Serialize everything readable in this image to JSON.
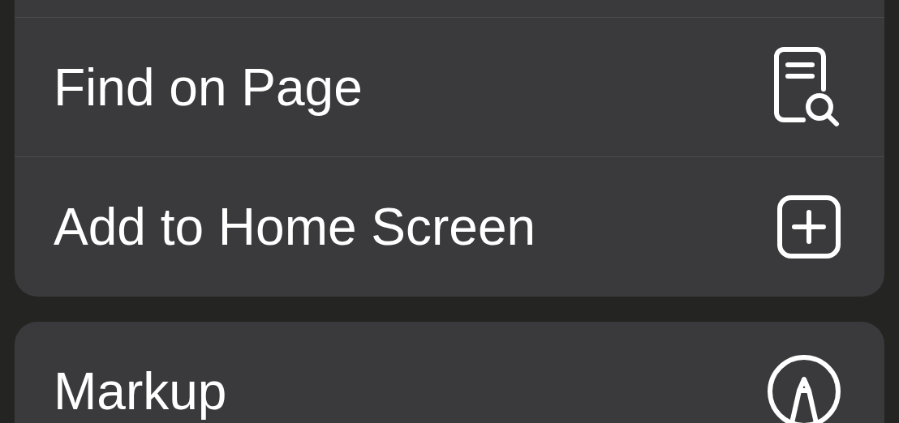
{
  "groups": [
    {
      "cut_top": true,
      "items": [
        {
          "label": "Find on Page",
          "kind": "find"
        },
        {
          "label": "Add to Home Screen",
          "kind": "add"
        }
      ]
    },
    {
      "cut_top": false,
      "items": [
        {
          "label": "Markup",
          "kind": "markup"
        }
      ]
    }
  ]
}
